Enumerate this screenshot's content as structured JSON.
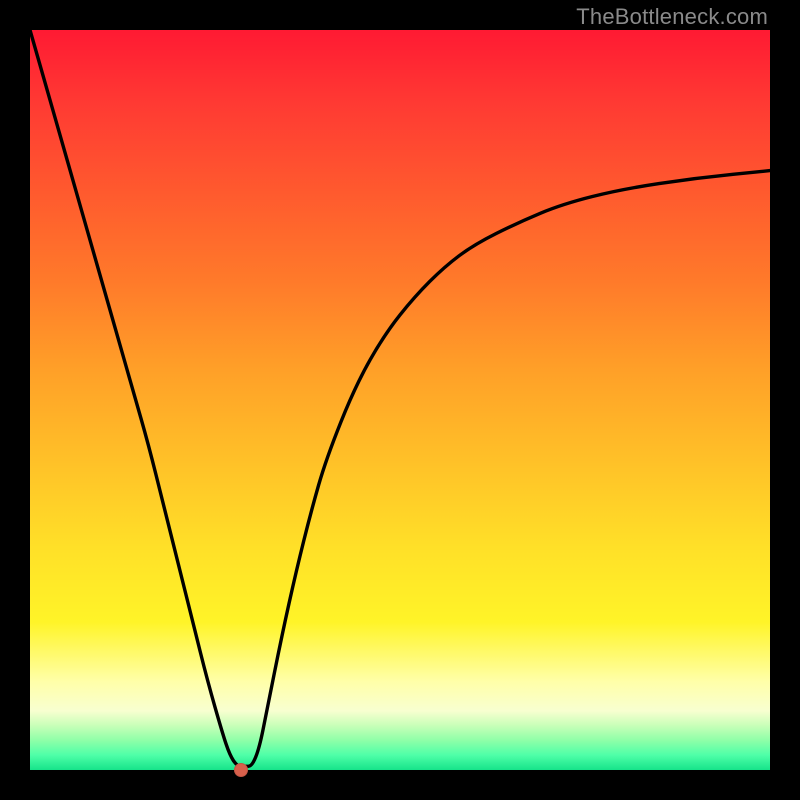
{
  "watermark": "TheBottleneck.com",
  "colors": {
    "curve_stroke": "#000000",
    "min_marker": "#d8604c",
    "frame_bg": "#000000"
  },
  "chart_data": {
    "type": "line",
    "title": "",
    "xlabel": "",
    "ylabel": "",
    "xlim": [
      0,
      100
    ],
    "ylim": [
      0,
      100
    ],
    "grid": false,
    "legend": false,
    "series": [
      {
        "name": "bottleneck_curve",
        "x": [
          0,
          2,
          4,
          6,
          8,
          10,
          12,
          14,
          16,
          18,
          20,
          22,
          24,
          26,
          27,
          28,
          29,
          30,
          31,
          32,
          34,
          36,
          38,
          40,
          44,
          48,
          52,
          56,
          60,
          66,
          72,
          80,
          90,
          100
        ],
        "values": [
          100,
          93,
          86,
          79,
          72,
          65,
          58,
          51,
          44,
          36,
          28,
          20,
          12,
          5,
          2,
          0.5,
          0.5,
          0.5,
          3,
          8,
          18,
          27,
          35,
          42,
          52,
          59,
          64,
          68,
          71,
          74,
          76.5,
          78.5,
          80,
          81
        ]
      }
    ],
    "minimum_marker": {
      "x": 28.5,
      "y": 0
    }
  }
}
